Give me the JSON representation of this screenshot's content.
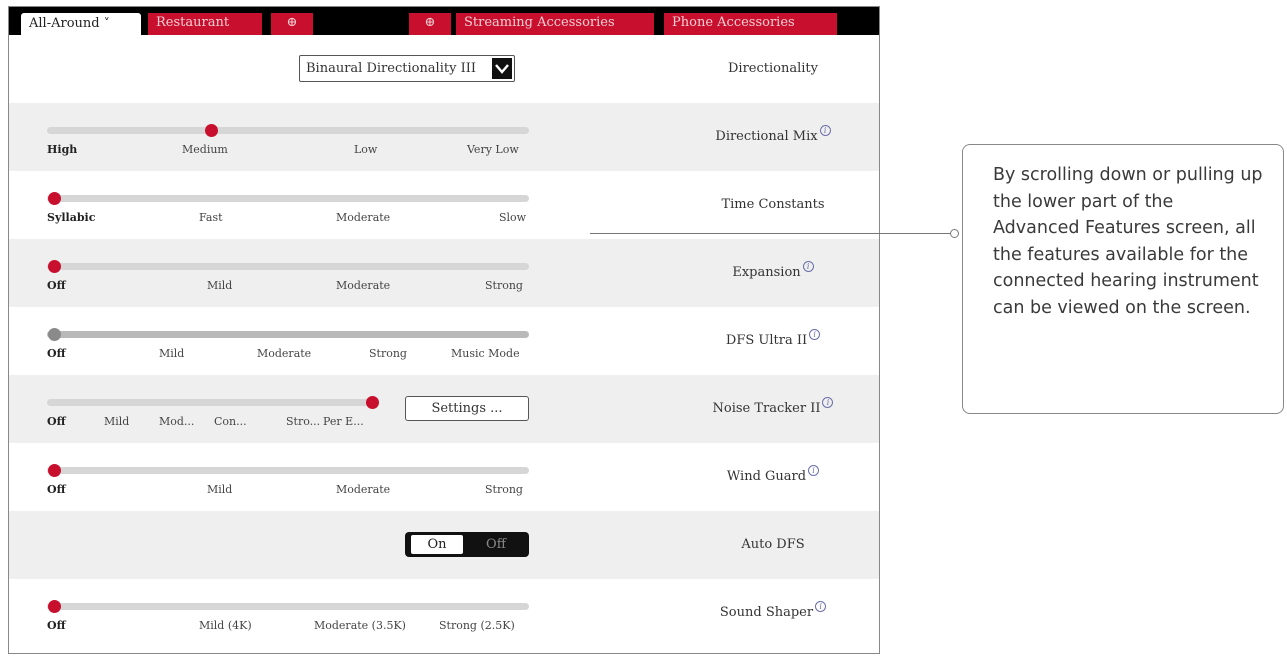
{
  "tabs": [
    {
      "label": "All-Around",
      "active": true
    },
    {
      "label": "Restaurant"
    },
    {
      "label": "⊕"
    },
    {
      "label": "⊕"
    },
    {
      "label": "Streaming Accessories"
    },
    {
      "label": "Phone Accessories"
    }
  ],
  "tab_dropdown_glyph": "˅",
  "rows": {
    "directionality": {
      "label": "Directionality",
      "selected": "Binaural Directionality III"
    },
    "directional_mix": {
      "label": "Directional Mix",
      "ticks": [
        "High",
        "Medium",
        "Low",
        "Very Low"
      ],
      "selected_index": 1,
      "selected_fraction": 0.333
    },
    "time_constants": {
      "label": "Time Constants",
      "ticks": [
        "Syllabic",
        "Fast",
        "Moderate",
        "Slow"
      ],
      "selected_index": 0,
      "selected_fraction": 0
    },
    "expansion": {
      "label": "Expansion",
      "ticks": [
        "Off",
        "Mild",
        "Moderate",
        "Strong"
      ],
      "selected_index": 0,
      "selected_fraction": 0
    },
    "dfs_ultra": {
      "label": "DFS Ultra II",
      "ticks": [
        "Off",
        "Mild",
        "Moderate",
        "Strong",
        "Music Mode"
      ],
      "selected_index": 0,
      "selected_fraction": 0
    },
    "noise_tracker": {
      "label": "Noise Tracker II",
      "ticks": [
        "Off",
        "Mild",
        "Mod...",
        "Con...",
        "Stro...",
        "Per E..."
      ],
      "selected_index": 5,
      "selected_fraction": 1,
      "settings_label": "Settings ..."
    },
    "wind_guard": {
      "label": "Wind Guard",
      "ticks": [
        "Off",
        "Mild",
        "Moderate",
        "Strong"
      ],
      "selected_index": 0,
      "selected_fraction": 0
    },
    "auto_dfs": {
      "label": "Auto DFS",
      "on_label": "On",
      "off_label": "Off",
      "value": "On"
    },
    "sound_shaper": {
      "label": "Sound Shaper",
      "ticks": [
        "Off",
        "Mild (4K)",
        "Moderate (3.5K)",
        "Strong (2.5K)"
      ],
      "selected_index": 0,
      "selected_fraction": 0
    }
  },
  "info_glyph": "i",
  "callout": {
    "text": "By scrolling down or pulling up the lower part of the Advanced Features screen, all the features available for the connected hearing instrument can be viewed on the screen."
  },
  "colors": {
    "accent": "#c8102e",
    "thumb_inactive": "#8a8a8a",
    "track": "#d6d6d6",
    "alt_row": "#efefef",
    "tabbar": "#000000"
  }
}
